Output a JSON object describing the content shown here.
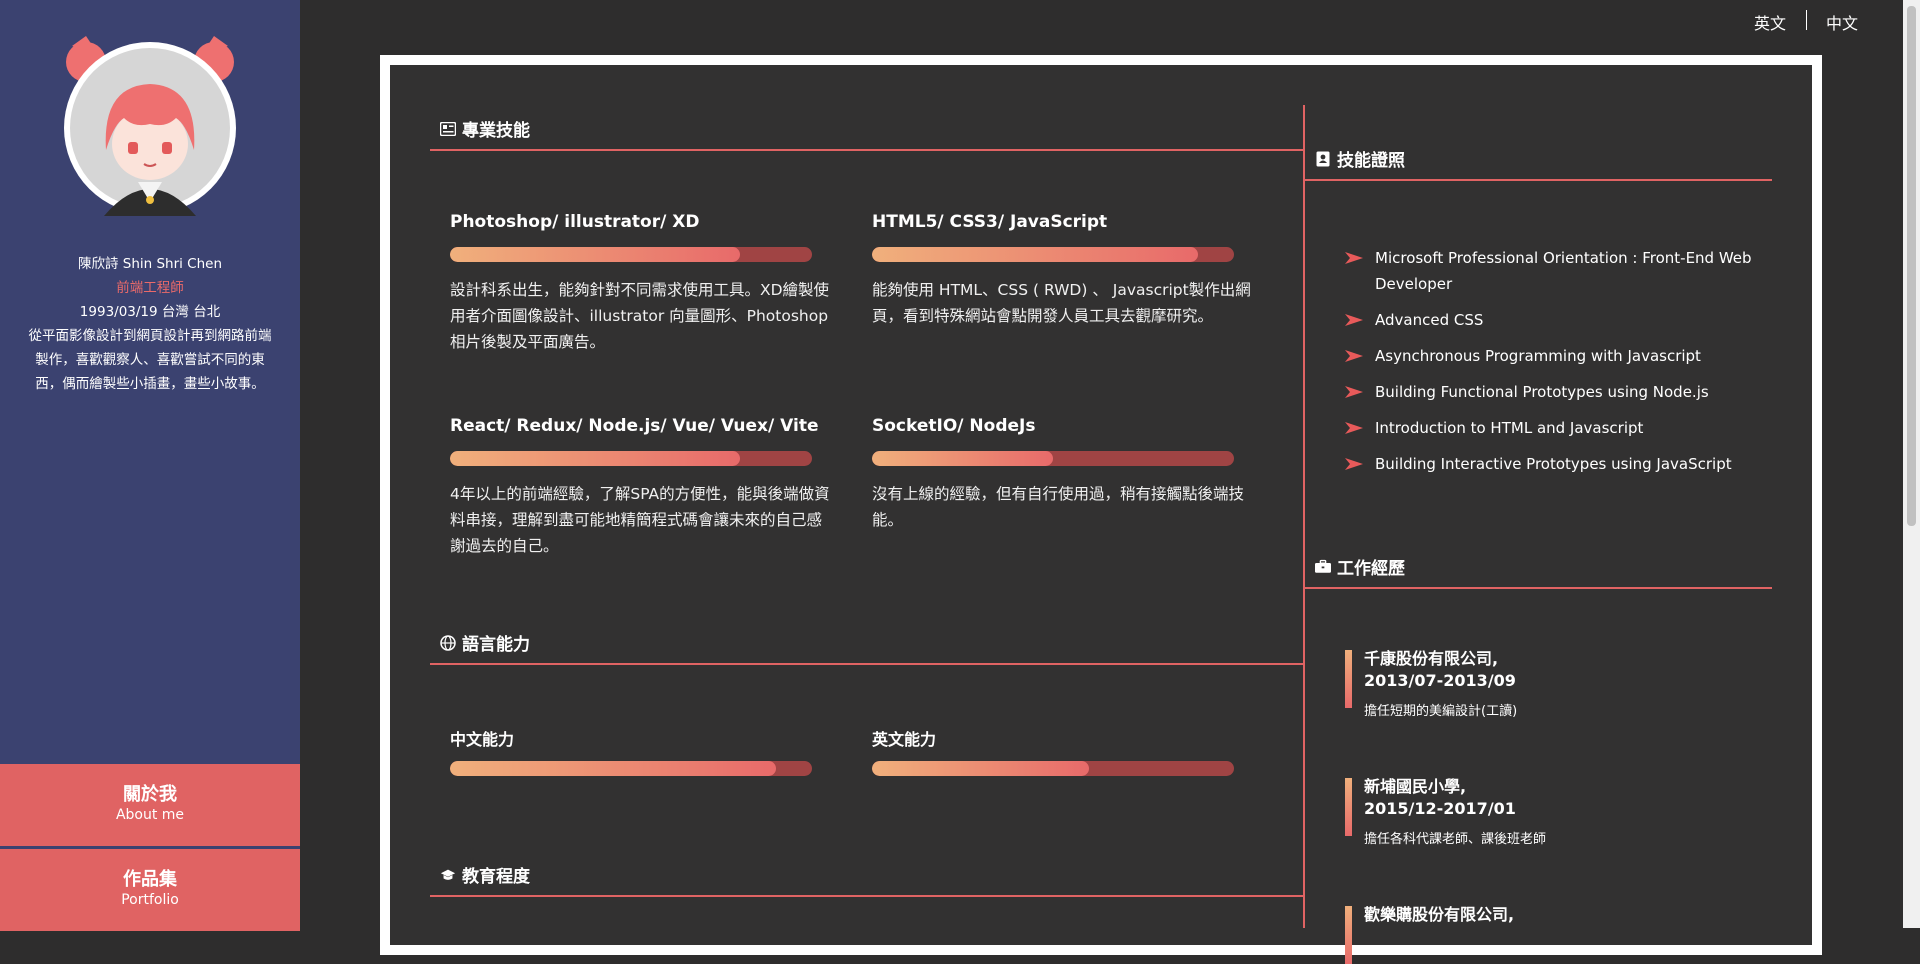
{
  "topbar": {
    "lang_en": "英文",
    "lang_zh": "中文"
  },
  "profile": {
    "name": "陳欣詩  Shin Shri Chen",
    "role": "前端工程師",
    "birth": "1993/03/19 台灣 台北",
    "bio": "從平面影像設計到網頁設計再到網路前端製作，喜歡觀察人、喜歡嘗試不同的東西，偶而繪製些小插畫，畫些小故事。"
  },
  "nav": {
    "about_zh": "關於我",
    "about_en": "About me",
    "portfolio_zh": "作品集",
    "portfolio_en": "Portfolio"
  },
  "skills": {
    "heading": "專業技能",
    "items": [
      {
        "title": "Photoshop/ illustrator/ XD",
        "level": 0.8,
        "desc": "設計科系出生，能夠針對不同需求使用工具。XD繪製使用者介面圖像設計、illustrator 向量圖形、Photoshop 相片後製及平面廣告。"
      },
      {
        "title": "HTML5/ CSS3/ JavaScript",
        "level": 0.9,
        "desc": "能夠使用 HTML、CSS ( RWD) 、 Javascript製作出網頁，看到特殊網站會點開發人員工具去觀摩研究。"
      },
      {
        "title": "React/ Redux/ Node.js/ Vue/ Vuex/ Vite",
        "level": 0.8,
        "desc": "4年以上的前端經驗，了解SPA的方便性，能與後端做資料串接，理解到盡可能地精簡程式碼會讓未來的自己感謝過去的自己。"
      },
      {
        "title": "SocketIO/ NodeJs",
        "level": 0.5,
        "desc": "沒有上線的經驗，但有自行使用過，稍有接觸點後端技能。"
      }
    ]
  },
  "languages": {
    "heading": "語言能力",
    "items": [
      {
        "title": "中文能力",
        "level": 0.9
      },
      {
        "title": "英文能力",
        "level": 0.6
      }
    ]
  },
  "education": {
    "heading": "教育程度"
  },
  "certs": {
    "heading": "技能證照",
    "items": [
      "Microsoft Professional Orientation : Front-End Web Developer",
      "Advanced CSS",
      "Asynchronous Programming with Javascript",
      "Building Functional Prototypes using Node.js",
      "Introduction to HTML and Javascript",
      "Building Interactive Prototypes using JavaScript"
    ]
  },
  "jobs": {
    "heading": "工作經歷",
    "items": [
      {
        "company": "千康股份有限公司,",
        "period": "2013/07-2013/09",
        "desc": "擔任短期的美編設計(工讀)"
      },
      {
        "company": "新埔國民小學,",
        "period": "2015/12-2017/01",
        "desc": "擔任各科代課老師、課後班老師"
      },
      {
        "company": "歡樂購股份有限公司,",
        "period": "",
        "desc": ""
      }
    ]
  },
  "colors": {
    "accent": "#e06363",
    "sidebar": "#3b4270",
    "background": "#2e2d2d"
  }
}
